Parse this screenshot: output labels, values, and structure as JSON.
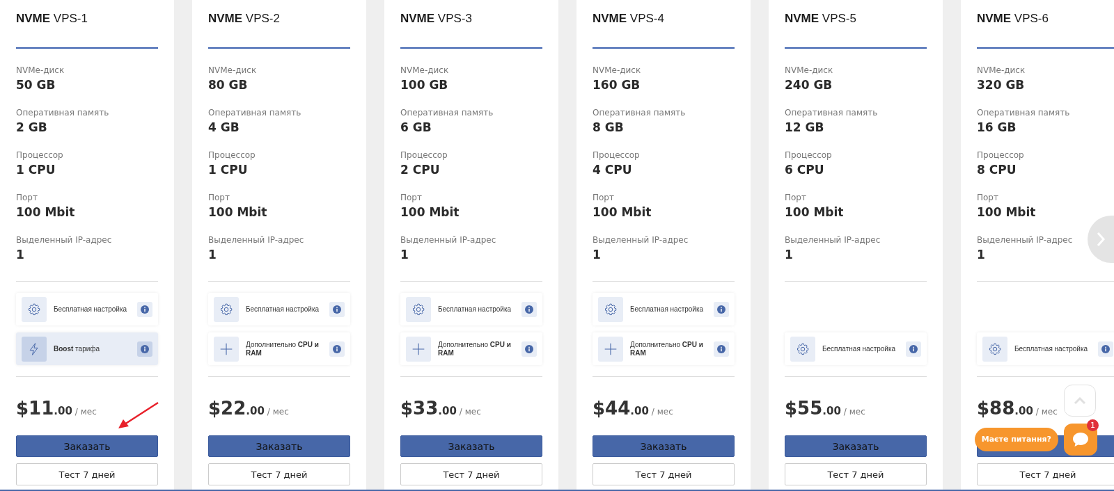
{
  "plans": [
    {
      "title": "**NVME** VPS-1",
      "specs": [
        {
          "label": "NVMe-диск",
          "value": "50 GB"
        },
        {
          "label": "Оперативная память",
          "value": "2 GB"
        },
        {
          "label": "Процессор",
          "value": "1 CPU"
        },
        {
          "label": "Порт",
          "value": "100 Mbit"
        },
        {
          "label": "Выделенный IP-адрес",
          "value": "1"
        }
      ],
      "features": [
        {
          "kind": "setup",
          "text": "Бесплатная настройка"
        },
        {
          "kind": "boost",
          "text": "**Boost** тарифа"
        }
      ],
      "price": {
        "amount": "$11",
        "cents": ".00",
        "period": "/ мес"
      },
      "order_label": "Заказать",
      "test_label": "Тест 7 дней"
    },
    {
      "title": "**NVME** VPS-2",
      "specs": [
        {
          "label": "NVMe-диск",
          "value": "80 GB"
        },
        {
          "label": "Оперативная память",
          "value": "4 GB"
        },
        {
          "label": "Процессор",
          "value": "1 CPU"
        },
        {
          "label": "Порт",
          "value": "100 Mbit"
        },
        {
          "label": "Выделенный IP-адрес",
          "value": "1"
        }
      ],
      "features": [
        {
          "kind": "setup",
          "text": "Бесплатная настройка"
        },
        {
          "kind": "extra",
          "text": "Дополнительно **CPU и RAM**"
        }
      ],
      "price": {
        "amount": "$22",
        "cents": ".00",
        "period": "/ мес"
      },
      "order_label": "Заказать",
      "test_label": "Тест 7 дней"
    },
    {
      "title": "**NVME** VPS-3",
      "specs": [
        {
          "label": "NVMe-диск",
          "value": "100 GB"
        },
        {
          "label": "Оперативная память",
          "value": "6 GB"
        },
        {
          "label": "Процессор",
          "value": "2 CPU"
        },
        {
          "label": "Порт",
          "value": "100 Mbit"
        },
        {
          "label": "Выделенный IP-адрес",
          "value": "1"
        }
      ],
      "features": [
        {
          "kind": "setup",
          "text": "Бесплатная настройка"
        },
        {
          "kind": "extra",
          "text": "Дополнительно **CPU и RAM**"
        }
      ],
      "price": {
        "amount": "$33",
        "cents": ".00",
        "period": "/ мес"
      },
      "order_label": "Заказать",
      "test_label": "Тест 7 дней"
    },
    {
      "title": "**NVME** VPS-4",
      "specs": [
        {
          "label": "NVMe-диск",
          "value": "160 GB"
        },
        {
          "label": "Оперативная память",
          "value": "8 GB"
        },
        {
          "label": "Процессор",
          "value": "4 CPU"
        },
        {
          "label": "Порт",
          "value": "100 Mbit"
        },
        {
          "label": "Выделенный IP-адрес",
          "value": "1"
        }
      ],
      "features": [
        {
          "kind": "setup",
          "text": "Бесплатная настройка"
        },
        {
          "kind": "extra",
          "text": "Дополнительно **CPU и RAM**"
        }
      ],
      "price": {
        "amount": "$44",
        "cents": ".00",
        "period": "/ мес"
      },
      "order_label": "Заказать",
      "test_label": "Тест 7 дней"
    },
    {
      "title": "**NVME** VPS-5",
      "specs": [
        {
          "label": "NVMe-диск",
          "value": "240 GB"
        },
        {
          "label": "Оперативная память",
          "value": "12 GB"
        },
        {
          "label": "Процессор",
          "value": "6 CPU"
        },
        {
          "label": "Порт",
          "value": "100 Mbit"
        },
        {
          "label": "Выделенный IP-адрес",
          "value": "1"
        }
      ],
      "features": [
        {
          "kind": "setup",
          "text": "Бесплатная настройка"
        }
      ],
      "price": {
        "amount": "$55",
        "cents": ".00",
        "period": "/ мес"
      },
      "order_label": "Заказать",
      "test_label": "Тест 7 дней"
    },
    {
      "title": "**NVME** VPS-6",
      "specs": [
        {
          "label": "NVMe-диск",
          "value": "320 GB"
        },
        {
          "label": "Оперативная память",
          "value": "16 GB"
        },
        {
          "label": "Процессор",
          "value": "8 CPU"
        },
        {
          "label": "Порт",
          "value": "100 Mbit"
        },
        {
          "label": "Выделенный IP-адрес",
          "value": "1"
        }
      ],
      "features": [
        {
          "kind": "setup",
          "text": "Бесплатная настройка"
        }
      ],
      "price": {
        "amount": "$88",
        "cents": ".00",
        "period": "/ мес"
      },
      "test_label": "Тест 7 дней"
    }
  ],
  "chat": {
    "prompt": "Маєте питання?",
    "badge": "1"
  }
}
